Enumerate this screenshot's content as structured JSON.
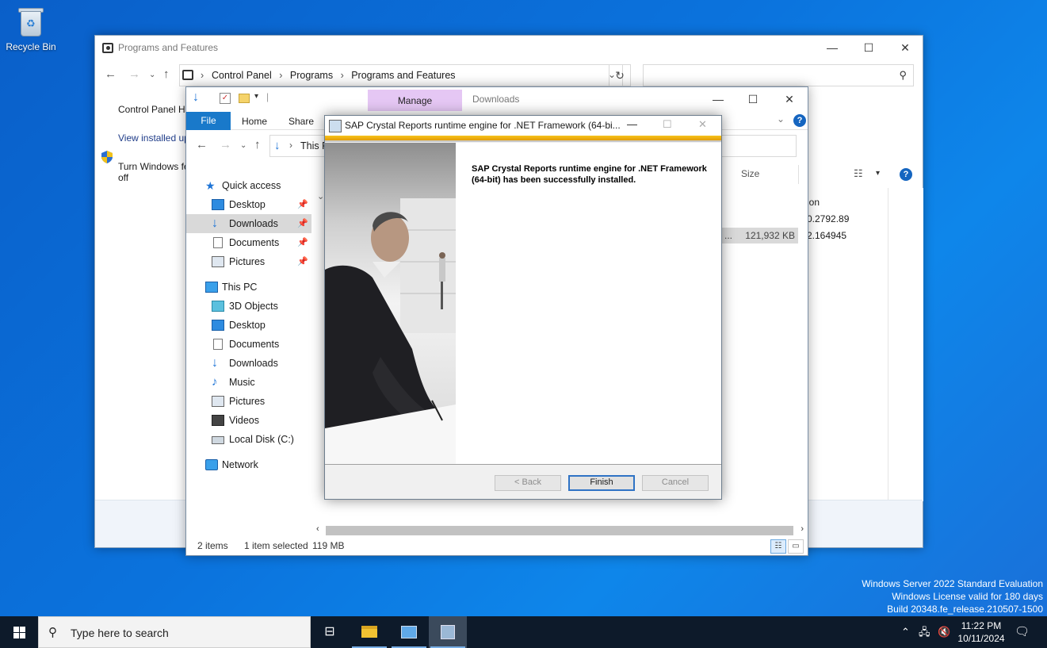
{
  "desktop": {
    "recycle_bin_label": "Recycle Bin"
  },
  "programs_window": {
    "title": "Programs and Features",
    "breadcrumbs": [
      "Control Panel",
      "Programs",
      "Programs and Features"
    ],
    "left_links": {
      "home": "Control Panel Ho",
      "view_updates": "View installed up",
      "turn_features_line1": "Turn Windows fe",
      "turn_features_line2": "off"
    },
    "partial_column_header": "ion",
    "partial_versions": [
      "0.2792.89",
      "2.164945"
    ]
  },
  "explorer_window": {
    "ribbon_tabs": {
      "file": "File",
      "home": "Home",
      "share": "Share",
      "manage": "Manage",
      "context": "Downloads"
    },
    "address_text": "This P",
    "column_size_header": "Size",
    "selected_file_truncated": "...",
    "selected_file_size": "121,932 KB",
    "nav": {
      "quick_access": "Quick access",
      "qa_items": [
        {
          "label": "Desktop",
          "icon": "desktop-icon"
        },
        {
          "label": "Downloads",
          "icon": "downloads-icon"
        },
        {
          "label": "Documents",
          "icon": "documents-icon"
        },
        {
          "label": "Pictures",
          "icon": "pictures-icon"
        }
      ],
      "this_pc": "This PC",
      "pc_items": [
        {
          "label": "3D Objects",
          "icon": "3d-objects-icon"
        },
        {
          "label": "Desktop",
          "icon": "desktop-icon"
        },
        {
          "label": "Documents",
          "icon": "documents-icon"
        },
        {
          "label": "Downloads",
          "icon": "downloads-icon"
        },
        {
          "label": "Music",
          "icon": "music-icon"
        },
        {
          "label": "Pictures",
          "icon": "pictures-icon"
        },
        {
          "label": "Videos",
          "icon": "videos-icon"
        },
        {
          "label": "Local Disk (C:)",
          "icon": "local-disk-icon"
        }
      ],
      "network": "Network"
    },
    "status": {
      "items": "2 items",
      "selected": "1 item selected",
      "size": "119 MB"
    }
  },
  "installer_dialog": {
    "title": "SAP Crystal Reports runtime engine for .NET Framework (64-bi...",
    "message": "SAP Crystal Reports runtime engine for .NET Framework (64-bit) has been successfully installed.",
    "buttons": {
      "back": "< Back",
      "finish": "Finish",
      "cancel": "Cancel"
    }
  },
  "watermark": {
    "line1": "Windows Server 2022 Standard Evaluation",
    "line2": "Windows License valid for 180 days",
    "line3": "Build 20348.fe_release.210507-1500"
  },
  "taskbar": {
    "search_placeholder": "Type here to search",
    "time": "11:22 PM",
    "date": "10/11/2024"
  },
  "colors": {
    "desktop_blue": "#0b73dd",
    "ribbon_file_tab": "#1979ca",
    "manage_tab": "#e5c7f4",
    "installer_stripe": "#f7c31b",
    "taskbar": "#0d1a2a"
  }
}
